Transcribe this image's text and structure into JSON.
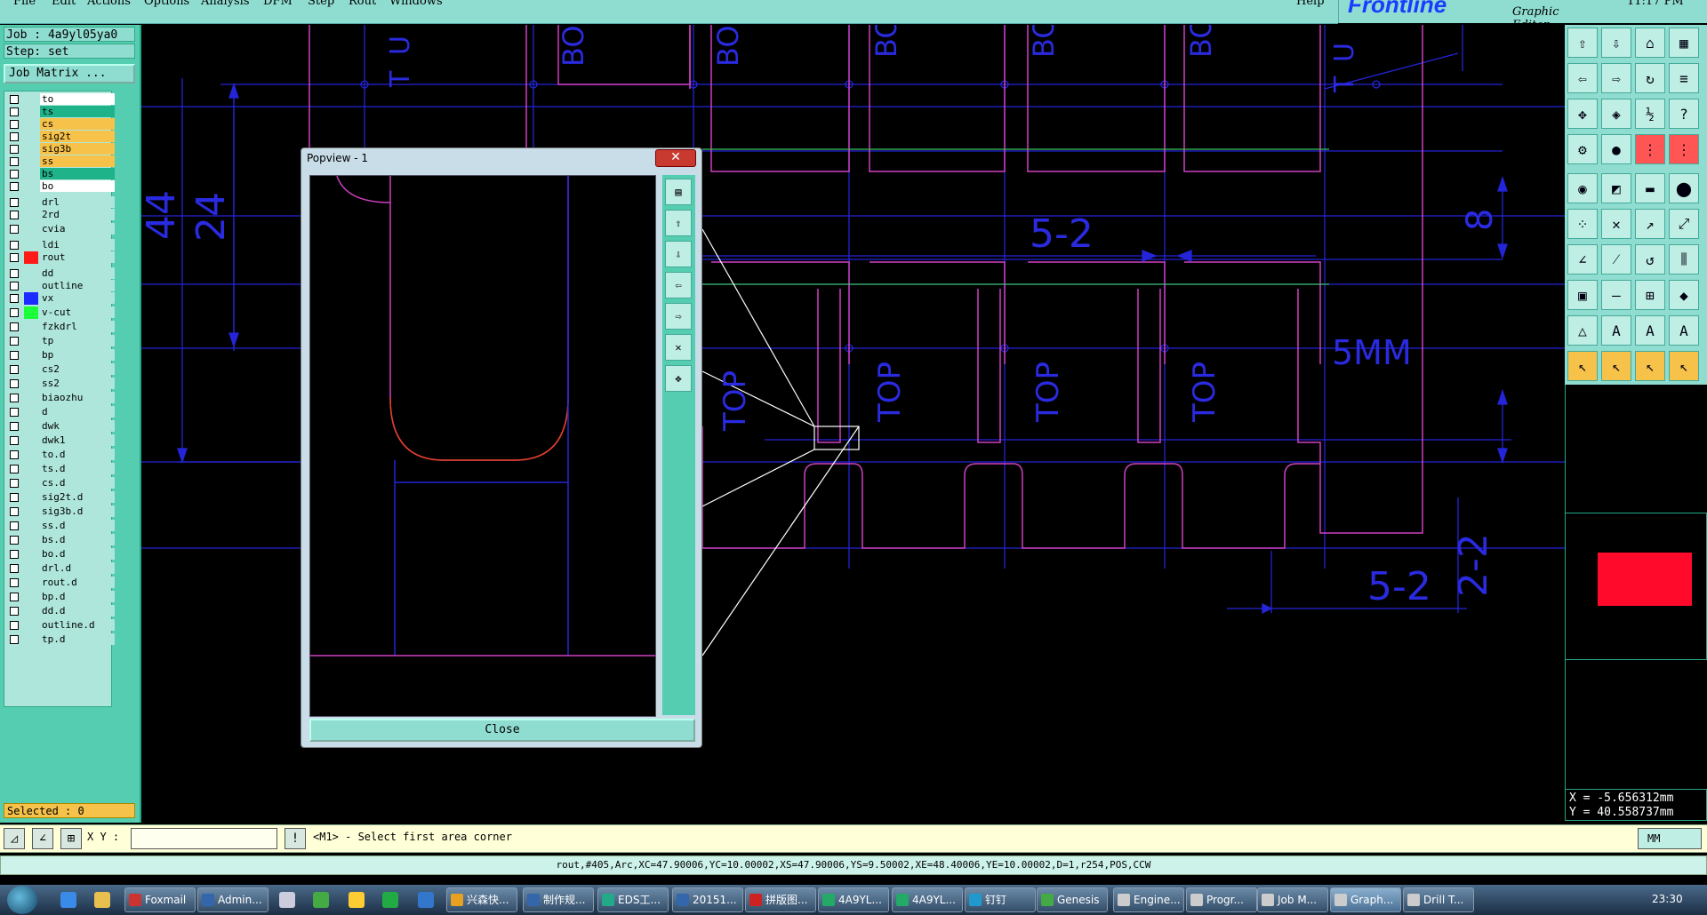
{
  "menu": {
    "items": [
      "File",
      "Edit",
      "Actions",
      "Options",
      "Analysis",
      "DFM",
      "Step",
      "Rout",
      "Windows"
    ],
    "help": "Help",
    "brand": "Frontline",
    "subtitle": "Graphic Editor",
    "clock": "11:17 PM"
  },
  "job": {
    "job_line": "Job : 4a9yl05ya0",
    "step_line": "Step: set",
    "matrix_button": "Job Matrix ..."
  },
  "layers": [
    {
      "name": "to",
      "color": "#ffffff"
    },
    {
      "name": "ts",
      "color": "#1fb38a"
    },
    {
      "name": "cs",
      "color": "#f7c24a"
    },
    {
      "name": "sig2t",
      "color": "#f7c24a"
    },
    {
      "name": "sig3b",
      "color": "#f7c24a"
    },
    {
      "name": "ss",
      "color": "#f7c24a"
    },
    {
      "name": "bs",
      "color": "#1fb38a"
    },
    {
      "name": "bo",
      "color": "#ffffff"
    },
    {
      "name": "drl",
      "color": "#aee6db"
    },
    {
      "name": "2rd",
      "color": "#aee6db"
    },
    {
      "name": "cvia",
      "color": "#aee6db"
    },
    {
      "name": "ldi",
      "color": "#aee6db"
    },
    {
      "name": "rout",
      "color": "#aee6db"
    },
    {
      "name": "dd",
      "color": "#aee6db"
    },
    {
      "name": "outline",
      "color": "#aee6db"
    },
    {
      "name": "vx",
      "color": "#aee6db"
    },
    {
      "name": "v-cut",
      "color": "#aee6db"
    },
    {
      "name": "fzkdrl",
      "color": "#aee6db"
    },
    {
      "name": "tp",
      "color": "#aee6db"
    },
    {
      "name": "bp",
      "color": "#aee6db"
    },
    {
      "name": "cs2",
      "color": "#aee6db"
    },
    {
      "name": "ss2",
      "color": "#aee6db"
    },
    {
      "name": "biaozhu",
      "color": "#aee6db"
    },
    {
      "name": "d",
      "color": "#aee6db"
    },
    {
      "name": "dwk",
      "color": "#aee6db"
    },
    {
      "name": "dwk1",
      "color": "#aee6db"
    },
    {
      "name": "to.d",
      "color": "#aee6db"
    },
    {
      "name": "ts.d",
      "color": "#aee6db"
    },
    {
      "name": "cs.d",
      "color": "#aee6db"
    },
    {
      "name": "sig2t.d",
      "color": "#aee6db"
    },
    {
      "name": "sig3b.d",
      "color": "#aee6db"
    },
    {
      "name": "ss.d",
      "color": "#aee6db"
    },
    {
      "name": "bs.d",
      "color": "#aee6db"
    },
    {
      "name": "bo.d",
      "color": "#aee6db"
    },
    {
      "name": "drl.d",
      "color": "#aee6db"
    },
    {
      "name": "rout.d",
      "color": "#aee6db"
    },
    {
      "name": "bp.d",
      "color": "#aee6db"
    },
    {
      "name": "dd.d",
      "color": "#aee6db"
    },
    {
      "name": "outline.d",
      "color": "#aee6db"
    },
    {
      "name": "tp.d",
      "color": "#aee6db"
    }
  ],
  "swatches": {
    "rout": "#ff1a1a",
    "vx": "#1a2cff",
    "v-cut": "#1aff3a"
  },
  "selected_text": "Selected : 0",
  "canvas_labels": {
    "dim_44": "44",
    "dim_24": "24",
    "dim_52a": "5-2",
    "dim_8": "8",
    "dim_5mm": "5MM",
    "dim_52b": "5-2",
    "dim_22": "2-2",
    "top": "TOP",
    "bo": "BO",
    "u": "U",
    "t": "T"
  },
  "popup": {
    "title": "Popview - 1",
    "close_label": "Close"
  },
  "coords": {
    "x": "X = -5.656312mm",
    "y": "Y = 40.558737mm"
  },
  "command": {
    "xy_label": "X Y :",
    "xy_value": "",
    "prompt": "<M1> - Select first area corner",
    "units": "MM"
  },
  "info_line": "rout,#405,Arc,XC=47.90006,YC=10.00002,XS=47.90006,YS=9.50002,XE=48.40006,YE=10.00002,D=1,r254,POS,CCW",
  "taskbar": {
    "tasks": [
      {
        "label": "Foxmail",
        "color": "#c33"
      },
      {
        "label": "Admin...",
        "color": "#36a"
      },
      {
        "label": "兴森快...",
        "color": "#e8a020"
      },
      {
        "label": "制作规...",
        "color": "#36a"
      },
      {
        "label": "EDS工...",
        "color": "#2a8"
      },
      {
        "label": "20151...",
        "color": "#36a"
      },
      {
        "label": "拼版图...",
        "color": "#c22"
      },
      {
        "label": "4A9YL...",
        "color": "#2a6"
      },
      {
        "label": "4A9YL...",
        "color": "#2a6"
      },
      {
        "label": "钉钉",
        "color": "#29c"
      },
      {
        "label": "Genesis",
        "color": "#4a4"
      },
      {
        "label": "Engine...",
        "color": "#ccc"
      },
      {
        "label": "Progr...",
        "color": "#ccc"
      },
      {
        "label": "Job M...",
        "color": "#ccc"
      },
      {
        "label": "Graph...",
        "color": "#ccc"
      },
      {
        "label": "Drill T...",
        "color": "#ccc"
      }
    ],
    "time": "23:30"
  }
}
